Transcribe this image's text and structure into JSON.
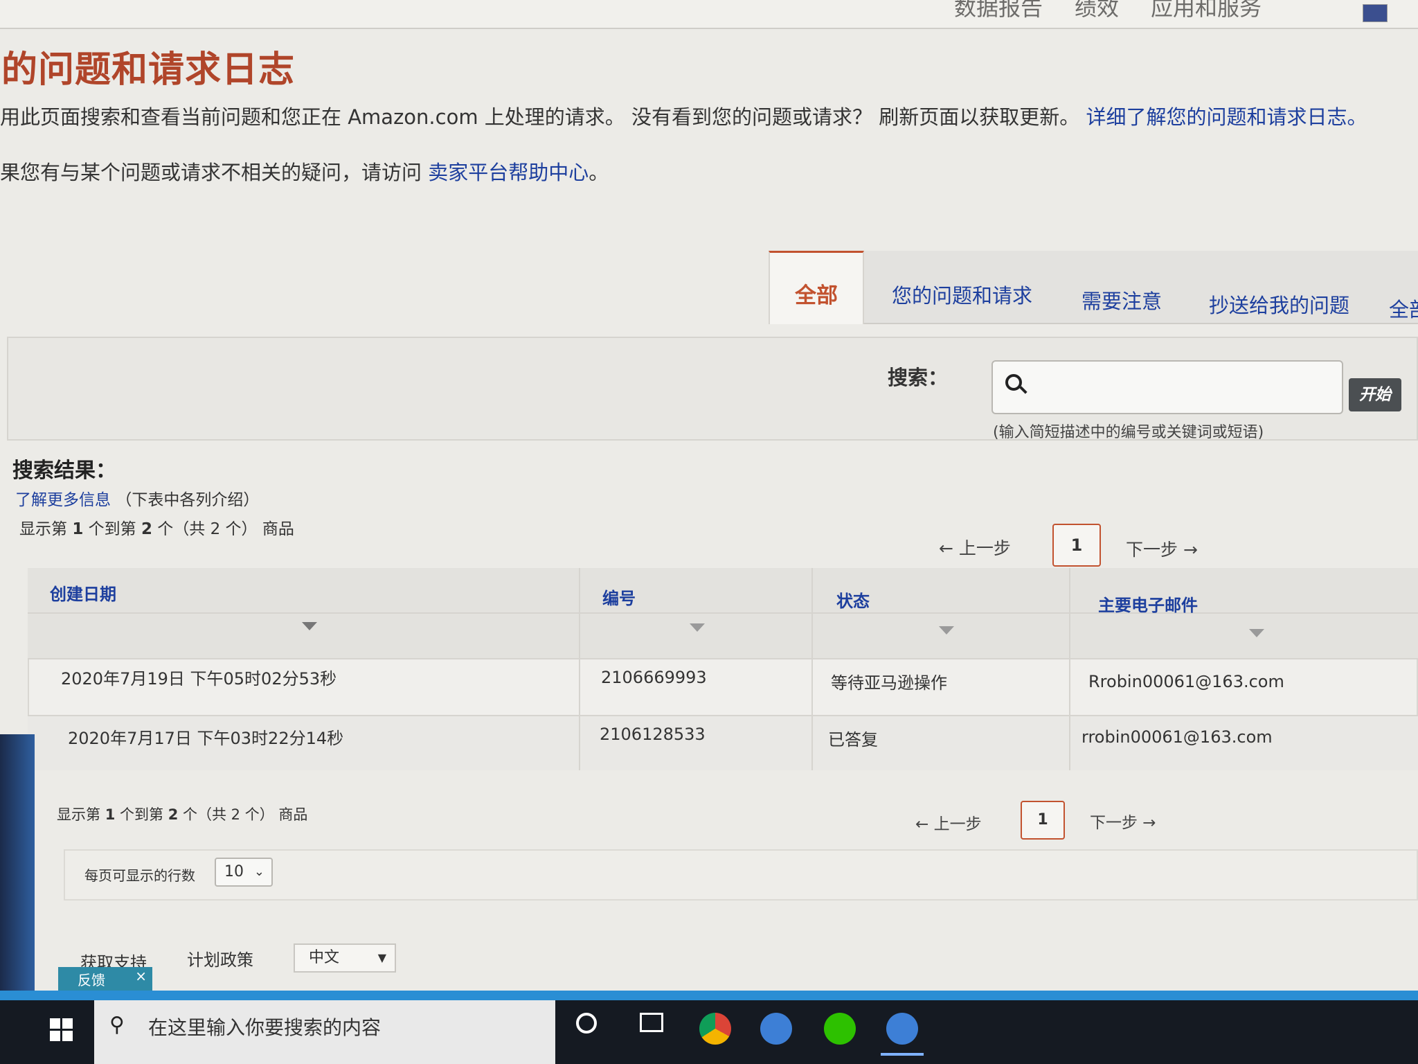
{
  "topnav": {
    "items": [
      "数据报告",
      "绩效",
      "应用和服务"
    ]
  },
  "page": {
    "title": "的问题和请求日志",
    "intro_line1": "用此页面搜索和查看当前问题和您正在 Amazon.com 上处理的请求。 没有看到您的问题或请求？ 刷新页面以获取更新。",
    "intro_line1_link": "详细了解您的问题和请求日志。",
    "intro_line2": "果您有与某个问题或请求不相关的疑问，请访问",
    "intro_line2_link": "卖家平台帮助中心",
    "intro_line2_end": "。"
  },
  "tabs": [
    {
      "label": "全部",
      "active": true
    },
    {
      "label": "您的问题和请求",
      "active": false
    },
    {
      "label": "需要注意",
      "active": false
    },
    {
      "label": "抄送给我的问题",
      "active": false
    },
    {
      "label": "全部",
      "active": false
    }
  ],
  "search": {
    "label": "搜索：",
    "value": "",
    "button": "开始",
    "hint": "(输入简短描述中的编号或关键词或短语)"
  },
  "results": {
    "title": "搜索结果：",
    "learn_more": "了解更多信息",
    "learn_more_suffix": "（下表中各列介绍）",
    "range_prefix": "显示第",
    "range_from": "1",
    "range_mid": "个到第",
    "range_to": "2",
    "range_suffix": "个（共 2 个） 商品"
  },
  "pagination": {
    "prev": "← 上一步",
    "page": "1",
    "next": "下一步 →"
  },
  "table": {
    "columns": [
      "创建日期",
      "编号",
      "状态",
      "主要电子邮件"
    ],
    "rows": [
      [
        "2020年7月19日 下午05时02分53秒",
        "2106669993",
        "等待亚马逊操作",
        "Rrobin00061@163.com"
      ],
      [
        "2020年7月17日 下午03时22分14秒",
        "2106128533",
        "已答复",
        "rrobin00061@163.com"
      ]
    ]
  },
  "rows_per_page": {
    "label": "每页可显示的行数",
    "value": "10"
  },
  "footer": {
    "support": "获取支持",
    "policy": "计划政策",
    "language": "中文",
    "feedback": "反馈"
  },
  "taskbar": {
    "search_placeholder": "在这里输入你要搜索的内容"
  },
  "colors": {
    "title": "#b0452a",
    "link": "#1d3f9e",
    "accent": "#c2522f",
    "taskbar": "#151a22"
  }
}
